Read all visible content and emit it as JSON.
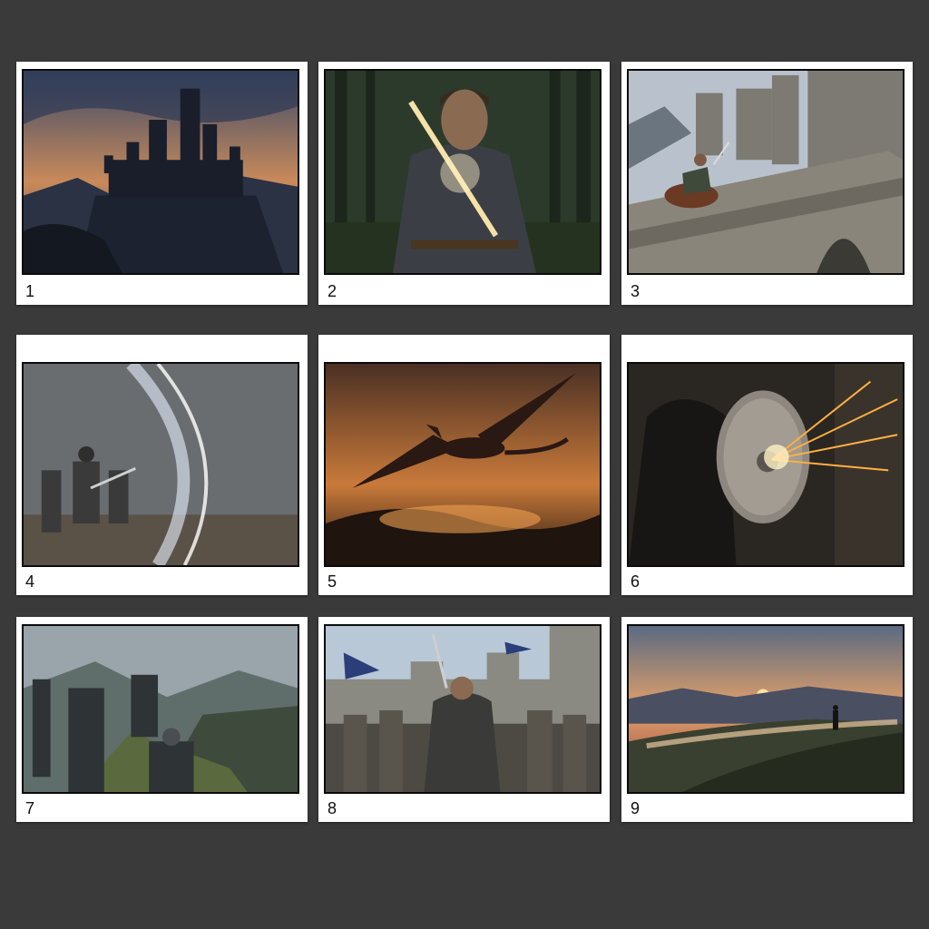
{
  "panels": [
    {
      "number": "1",
      "scene": "castle-cliff-dusk"
    },
    {
      "number": "2",
      "scene": "knight-glowing-sword"
    },
    {
      "number": "3",
      "scene": "rider-castle-bridge"
    },
    {
      "number": "4",
      "scene": "magic-shield-blast"
    },
    {
      "number": "5",
      "scene": "dragon-fire-sky"
    },
    {
      "number": "6",
      "scene": "shield-sparks"
    },
    {
      "number": "7",
      "scene": "army-mountain-ridge"
    },
    {
      "number": "8",
      "scene": "warriors-cheering-banners"
    },
    {
      "number": "9",
      "scene": "sunset-lake-lone-figure"
    }
  ],
  "colors": {
    "background": "#3a3a3b",
    "card": "#ffffff",
    "frame_border": "#0b0b0b"
  }
}
